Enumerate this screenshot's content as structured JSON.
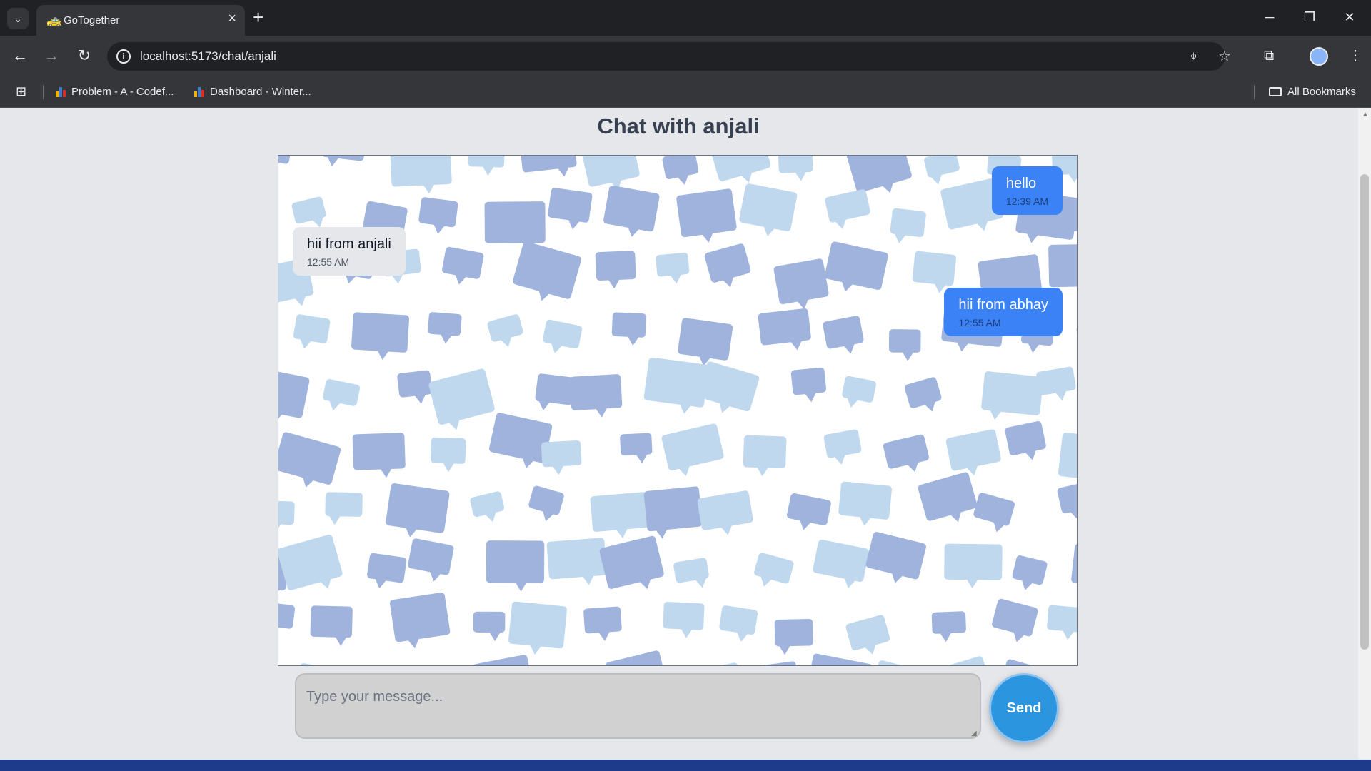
{
  "browser": {
    "tab": {
      "title": "GoTogether",
      "favicon": "car-emoji-icon"
    },
    "url": "localhost:5173/chat/anjali",
    "bookmarks": [
      {
        "label": "Problem - A - Codef..."
      },
      {
        "label": "Dashboard - Winter..."
      }
    ],
    "all_bookmarks_label": "All Bookmarks"
  },
  "chat": {
    "title": "Chat with anjali",
    "messages": [
      {
        "text": "hello",
        "time": "12:39 AM",
        "direction": "sent"
      },
      {
        "text": "hii from anjali",
        "time": "12:55 AM",
        "direction": "received"
      },
      {
        "text": "hii from abhay",
        "time": "12:55 AM",
        "direction": "sent"
      }
    ],
    "input": {
      "placeholder": "Type your message...",
      "value": ""
    },
    "send_label": "Send"
  },
  "colors": {
    "sent_bubble": "#3b82f6",
    "received_bubble": "#e5e7eb",
    "send_button": "#2b95e0",
    "pattern_light": "#bfd8ee",
    "pattern_dark": "#9fb3dd"
  }
}
